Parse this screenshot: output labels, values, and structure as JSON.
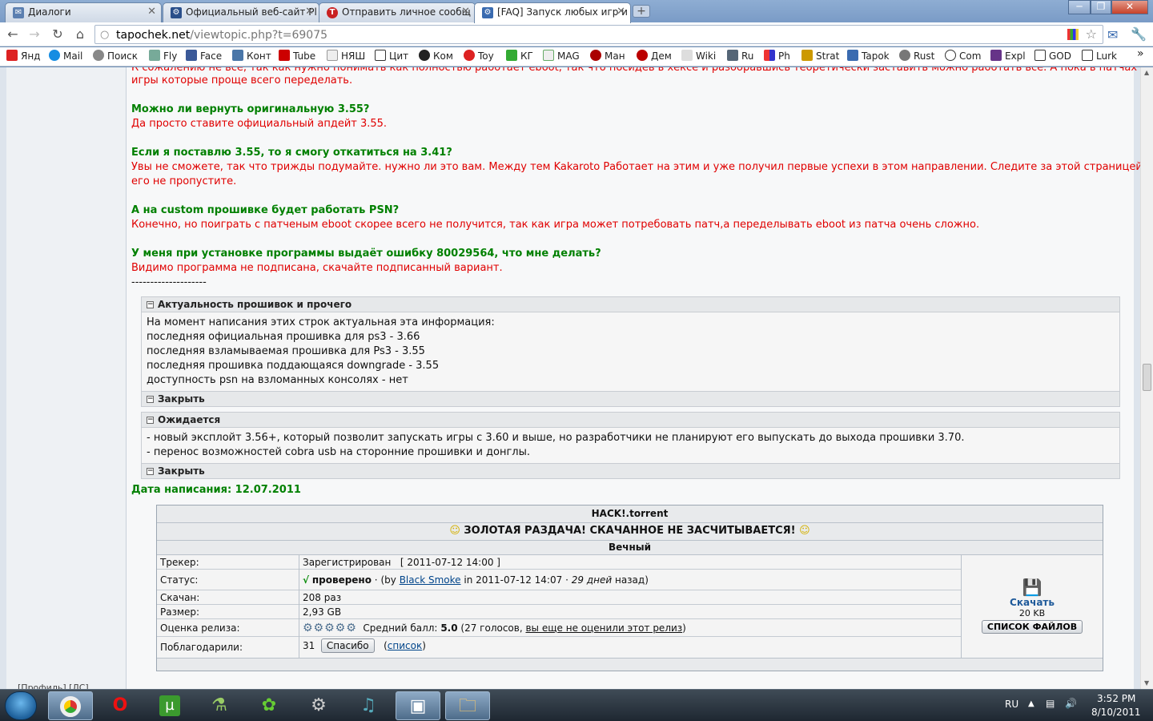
{
  "tabs": [
    {
      "label": "Диалоги",
      "icon": "dialogs-icon",
      "active": false
    },
    {
      "label": "Официальный веб-сайт Pl",
      "icon": "playstation-icon",
      "active": false
    },
    {
      "label": "Отправить личное сообщ",
      "icon": "tapochek-icon",
      "active": false
    },
    {
      "label": "[FAQ] Запуск любых игр и",
      "icon": "gear-icon",
      "active": true
    }
  ],
  "address": {
    "host": "tapochek.net",
    "path": "/viewtopic.php?t=69075"
  },
  "bookmarks": [
    "Янд",
    "Mail",
    "Поиск",
    "Fly",
    "Face",
    "Конт",
    "Tube",
    "НЯШ",
    "Цит",
    "Ком",
    "Toy",
    "КГ",
    "MAG",
    "Ман",
    "Дем",
    "Wiki",
    "Ru",
    "Ph",
    "Strat",
    "Tapok",
    "Rust",
    "Com",
    "Expl",
    "GOD",
    "Lurk"
  ],
  "bookmark_overflow": "»",
  "post": {
    "cut_line1": "К сожалению не все, так как нужно понимать как полностью работает eboot, так что посидев в хексе и разобравшись теоретически заставить можно работать все. А пока в патчах лежат",
    "cut_line2": "игры которые проще всего переделать.",
    "faq": [
      {
        "q": "Можно ли вернуть оригинальную 3.55?",
        "a": [
          "Да просто ставите официальный апдейт 3.55."
        ]
      },
      {
        "q": "Если я поставлю 3.55, то я смогу откатиться на 3.41?",
        "a": [
          "Увы не сможете, так что трижды подумайте. нужно ли это вам. Между тем Kakaroto Работает на этим и уже получил первые успехи в этом направлении. Следите за этой страницей и вы",
          "его не пропустите."
        ]
      },
      {
        "q": "А на custom прошивке будет работать PSN?",
        "a": [
          "Конечно, но поиграть с патченым eboot скорее всего не получится, так как игра может потребовать патч,а переделывать eboot из патча очень сложно."
        ]
      },
      {
        "q": "У меня при установке программы выдаёт ошибку 80029564, что мне делать?",
        "a": [
          "Видимо программа не подписана, скачайте подписанный вариант."
        ]
      }
    ],
    "dashes": "--------------------",
    "spoiler1": {
      "title": "Актуальность прошивок и прочего",
      "lines": [
        "На момент написания этих строк актуальная эта информация:",
        "последняя официальная прошивка для ps3 - 3.66",
        "последняя взламываемая прошивка для Ps3 - 3.55",
        "последняя прошивка поддающаяся downgrade - 3.55",
        "доступность psn на взломанных консолях - нет"
      ],
      "close": "Закрыть"
    },
    "spoiler2": {
      "title": "Ожидается",
      "lines": [
        "- новый эксплойт 3.56+, который позволит запускать игры с 3.60 и выше, но разработчики не планируют его выпускать до выхода прошивки 3.70.",
        "- перенос возможностей cobra usb на сторонние прошивки и донглы."
      ],
      "close": "Закрыть"
    },
    "date": "Дата написания: 12.07.2011"
  },
  "torrent": {
    "filename": "HACK!.torrent",
    "gold": "ЗОЛОТАЯ РАЗДАЧА! СКАЧАННОЕ НЕ ЗАСЧИТЫВАЕТСЯ!",
    "eternal": "Вечный",
    "tracker_k": "Трекер:",
    "tracker_v": "Зарегистрирован",
    "tracker_date": "[ 2011-07-12 14:00 ]",
    "status_k": "Статус:",
    "status_check": "√",
    "status_v": "проверено",
    "status_dot": "·",
    "status_by": "(by",
    "status_user": "Black Smoke",
    "status_in": "in 2011-07-12 14:07 ·",
    "status_ago": "29 дней",
    "status_tail": "назад)",
    "downloaded_k": "Скачан:",
    "downloaded_v": "208 раз",
    "size_k": "Размер:",
    "size_v": "2,93 GB",
    "rating_k": "Оценка релиза:",
    "rating_stars": 5,
    "rating_avg_label": "Средний балл:",
    "rating_avg": "5.0",
    "rating_votes": "(27 голосов,",
    "rating_link": "вы еще не оценили этот релиз",
    "rating_close": ")",
    "thanks_k": "Поблагодарили:",
    "thanks_count": "31",
    "thanks_btn": "Спасибо",
    "thanks_open": "(",
    "thanks_list": "список",
    "thanks_close": ")",
    "download": "Скачать",
    "download_size": "20 KB",
    "files_btn": "СПИСОК ФАЙЛОВ"
  },
  "left_bottom": "[Профиль] [ЛС]",
  "tray": {
    "lang": "RU",
    "time": "3:52 PM",
    "date": "8/10/2011"
  }
}
